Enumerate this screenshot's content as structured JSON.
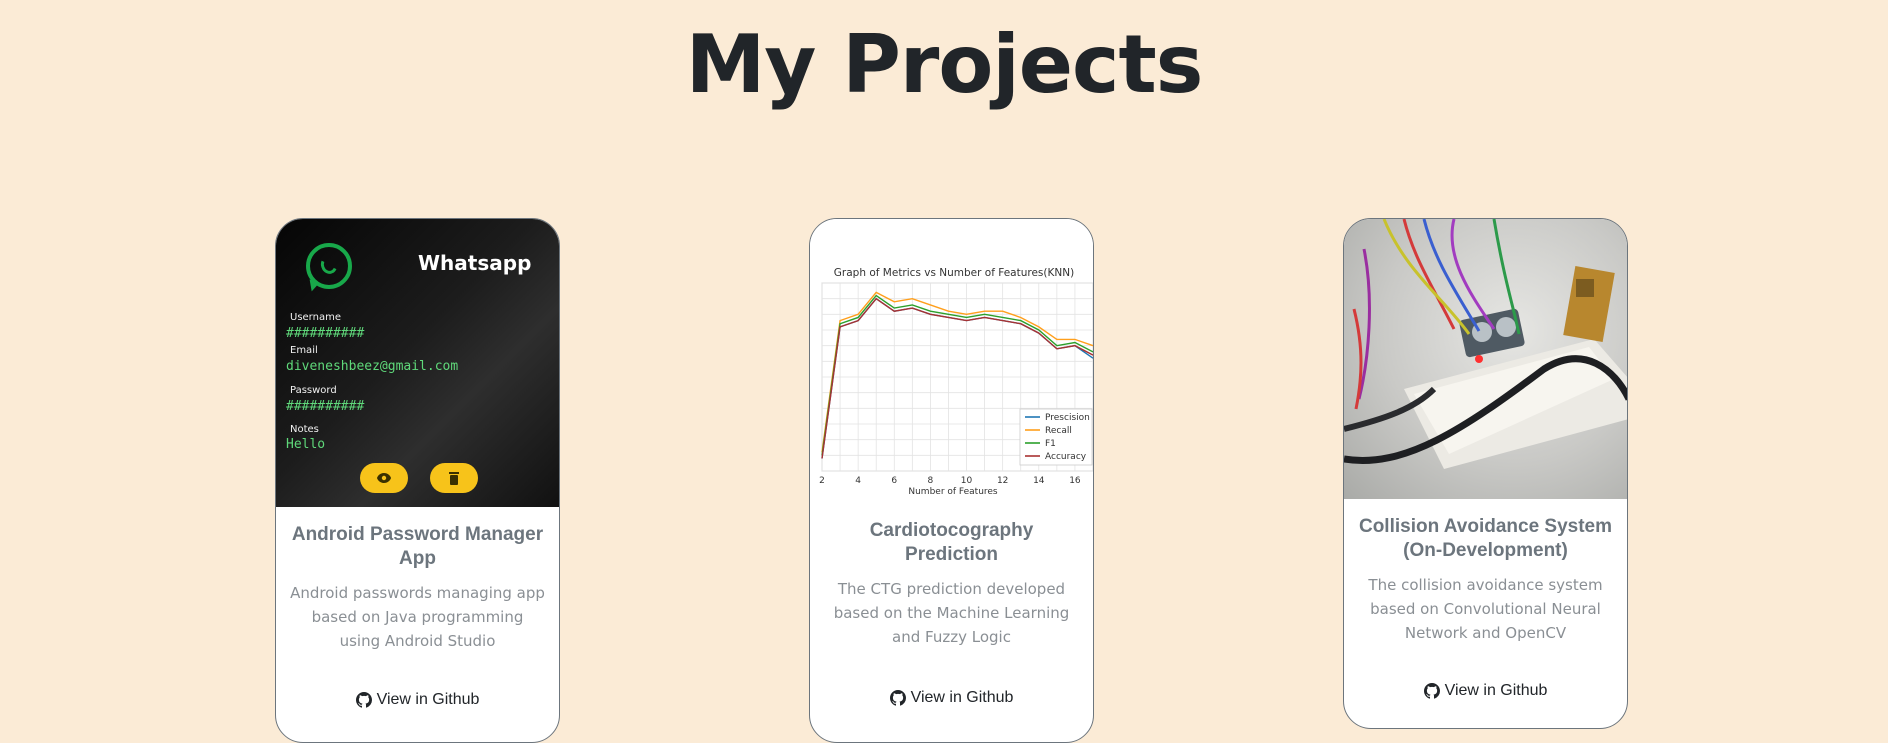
{
  "page": {
    "title": "My Projects"
  },
  "colors": {
    "background": "#fbebd6",
    "card_border": "#6c757d",
    "accent_yellow": "#f7c31a",
    "whatsapp_green": "#18a84a"
  },
  "projects": [
    {
      "title": "Android Password Manager App",
      "description": "Android passwords managing app based on Java programming using Android Studio",
      "link_label": "View in Github",
      "screenshot": {
        "app_name": "Whatsapp",
        "username_label": "Username",
        "username_value": "##########",
        "email_label": "Email",
        "email_value": "diveneshbeez@gmail.com",
        "password_label": "Password",
        "password_value": "##########",
        "notes_label": "Notes",
        "notes_value": "Hello",
        "icons": [
          "whatsapp-icon",
          "eye-icon",
          "trash-icon"
        ]
      }
    },
    {
      "title": "Cardiotocography Prediction",
      "description": "The CTG prediction developed based on the Machine Learning and Fuzzy Logic",
      "link_label": "View in Github"
    },
    {
      "title": "Collision Avoidance System (On-Development)",
      "description": "The collision avoidance system based on Convolutional Neural Network and OpenCV",
      "link_label": "View in Github"
    }
  ],
  "chart_data": {
    "type": "line",
    "title": "Graph of Metrics vs Number of Features(KNN)",
    "xlabel": "Number of Features",
    "ylabel": "",
    "x": [
      2,
      3,
      4,
      5,
      6,
      7,
      8,
      9,
      10,
      11,
      12,
      13,
      14,
      15,
      16,
      17
    ],
    "xticks": [
      2,
      4,
      6,
      8,
      10,
      12,
      14,
      16
    ],
    "ylim": [
      0.4,
      1.0
    ],
    "legend_position": "bottom-right",
    "grid": true,
    "series": [
      {
        "name": "Prescision",
        "color": "#1f77b4",
        "values": [
          0.44,
          0.86,
          0.88,
          0.95,
          0.91,
          0.92,
          0.9,
          0.89,
          0.88,
          0.89,
          0.88,
          0.87,
          0.84,
          0.79,
          0.8,
          0.76
        ]
      },
      {
        "name": "Recall",
        "color": "#ff9f1c",
        "values": [
          0.46,
          0.88,
          0.9,
          0.97,
          0.94,
          0.95,
          0.93,
          0.91,
          0.9,
          0.91,
          0.91,
          0.89,
          0.86,
          0.82,
          0.82,
          0.8
        ]
      },
      {
        "name": "F1",
        "color": "#2ca02c",
        "values": [
          0.45,
          0.87,
          0.89,
          0.96,
          0.92,
          0.93,
          0.91,
          0.9,
          0.89,
          0.9,
          0.89,
          0.88,
          0.85,
          0.8,
          0.81,
          0.78
        ]
      },
      {
        "name": "Accuracy",
        "color": "#a83232",
        "values": [
          0.44,
          0.86,
          0.88,
          0.95,
          0.91,
          0.92,
          0.9,
          0.89,
          0.88,
          0.89,
          0.88,
          0.87,
          0.84,
          0.79,
          0.8,
          0.77
        ]
      }
    ]
  }
}
